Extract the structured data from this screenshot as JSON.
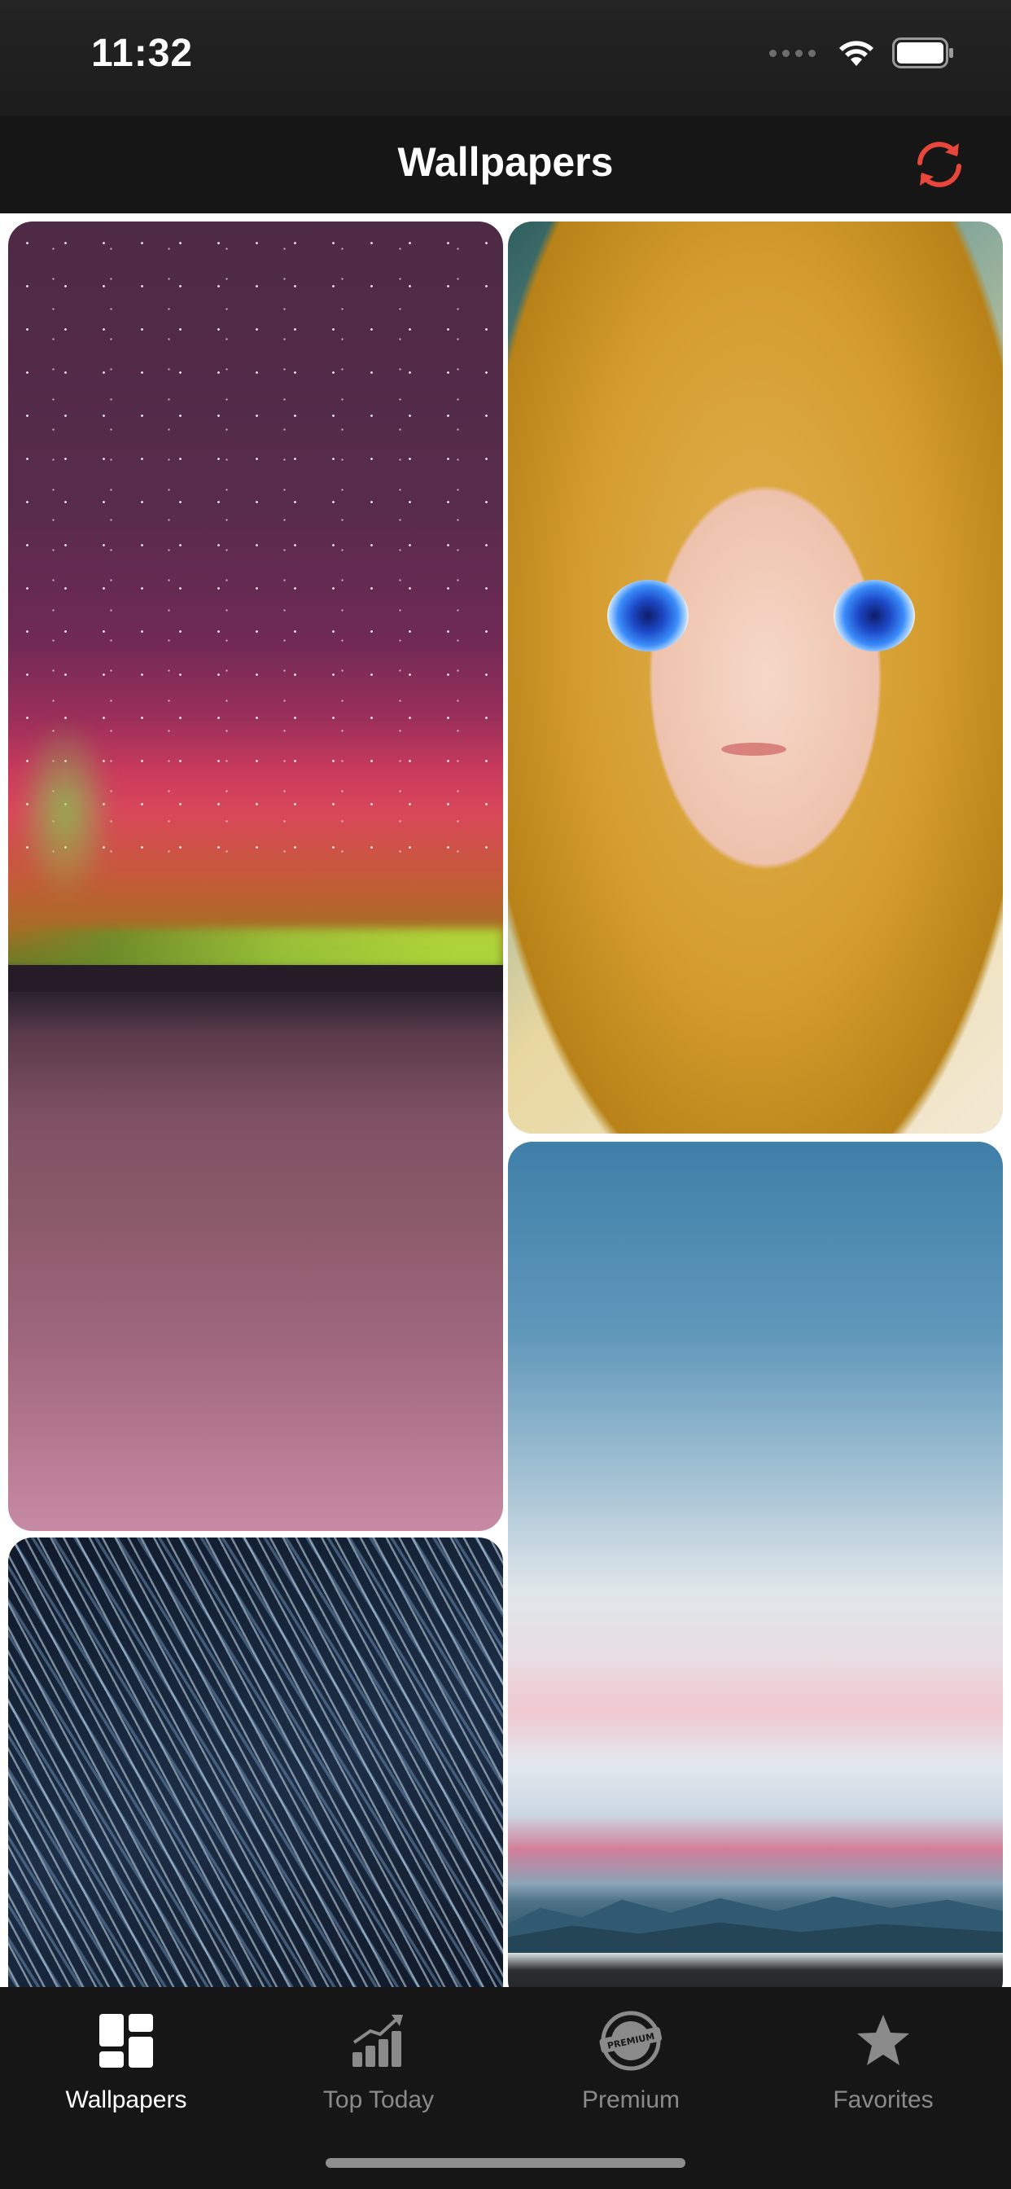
{
  "status_bar": {
    "time": "11:32"
  },
  "nav": {
    "title": "Wallpapers",
    "refresh_icon": "refresh-icon",
    "accent_color": "#e8463b"
  },
  "wallpapers": [
    {
      "name": "aurora-wallpaper"
    },
    {
      "name": "anime-girl-wallpaper"
    },
    {
      "name": "pastel-sky-wallpaper"
    },
    {
      "name": "star-trails-wallpaper"
    }
  ],
  "tabs": [
    {
      "label": "Wallpapers",
      "icon": "grid-icon",
      "active": true
    },
    {
      "label": "Top Today",
      "icon": "chart-icon",
      "active": false
    },
    {
      "label": "Premium",
      "icon": "premium-badge-icon",
      "active": false
    },
    {
      "label": "Favorites",
      "icon": "star-icon",
      "active": false
    }
  ],
  "premium_badge_text": "PREMIUM"
}
